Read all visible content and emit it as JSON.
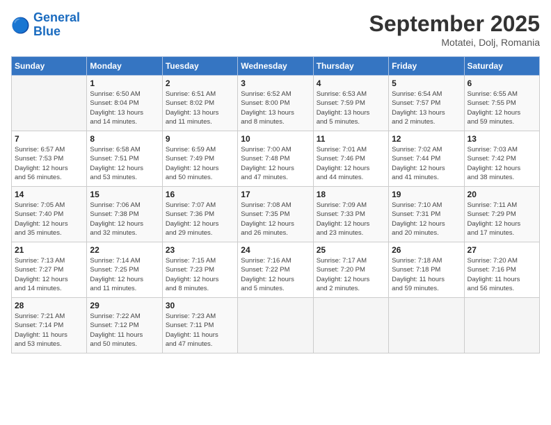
{
  "header": {
    "logo_line1": "General",
    "logo_line2": "Blue",
    "month": "September 2025",
    "location": "Motatei, Dolj, Romania"
  },
  "weekdays": [
    "Sunday",
    "Monday",
    "Tuesday",
    "Wednesday",
    "Thursday",
    "Friday",
    "Saturday"
  ],
  "weeks": [
    [
      {
        "day": "",
        "info": ""
      },
      {
        "day": "1",
        "info": "Sunrise: 6:50 AM\nSunset: 8:04 PM\nDaylight: 13 hours\nand 14 minutes."
      },
      {
        "day": "2",
        "info": "Sunrise: 6:51 AM\nSunset: 8:02 PM\nDaylight: 13 hours\nand 11 minutes."
      },
      {
        "day": "3",
        "info": "Sunrise: 6:52 AM\nSunset: 8:00 PM\nDaylight: 13 hours\nand 8 minutes."
      },
      {
        "day": "4",
        "info": "Sunrise: 6:53 AM\nSunset: 7:59 PM\nDaylight: 13 hours\nand 5 minutes."
      },
      {
        "day": "5",
        "info": "Sunrise: 6:54 AM\nSunset: 7:57 PM\nDaylight: 13 hours\nand 2 minutes."
      },
      {
        "day": "6",
        "info": "Sunrise: 6:55 AM\nSunset: 7:55 PM\nDaylight: 12 hours\nand 59 minutes."
      }
    ],
    [
      {
        "day": "7",
        "info": "Sunrise: 6:57 AM\nSunset: 7:53 PM\nDaylight: 12 hours\nand 56 minutes."
      },
      {
        "day": "8",
        "info": "Sunrise: 6:58 AM\nSunset: 7:51 PM\nDaylight: 12 hours\nand 53 minutes."
      },
      {
        "day": "9",
        "info": "Sunrise: 6:59 AM\nSunset: 7:49 PM\nDaylight: 12 hours\nand 50 minutes."
      },
      {
        "day": "10",
        "info": "Sunrise: 7:00 AM\nSunset: 7:48 PM\nDaylight: 12 hours\nand 47 minutes."
      },
      {
        "day": "11",
        "info": "Sunrise: 7:01 AM\nSunset: 7:46 PM\nDaylight: 12 hours\nand 44 minutes."
      },
      {
        "day": "12",
        "info": "Sunrise: 7:02 AM\nSunset: 7:44 PM\nDaylight: 12 hours\nand 41 minutes."
      },
      {
        "day": "13",
        "info": "Sunrise: 7:03 AM\nSunset: 7:42 PM\nDaylight: 12 hours\nand 38 minutes."
      }
    ],
    [
      {
        "day": "14",
        "info": "Sunrise: 7:05 AM\nSunset: 7:40 PM\nDaylight: 12 hours\nand 35 minutes."
      },
      {
        "day": "15",
        "info": "Sunrise: 7:06 AM\nSunset: 7:38 PM\nDaylight: 12 hours\nand 32 minutes."
      },
      {
        "day": "16",
        "info": "Sunrise: 7:07 AM\nSunset: 7:36 PM\nDaylight: 12 hours\nand 29 minutes."
      },
      {
        "day": "17",
        "info": "Sunrise: 7:08 AM\nSunset: 7:35 PM\nDaylight: 12 hours\nand 26 minutes."
      },
      {
        "day": "18",
        "info": "Sunrise: 7:09 AM\nSunset: 7:33 PM\nDaylight: 12 hours\nand 23 minutes."
      },
      {
        "day": "19",
        "info": "Sunrise: 7:10 AM\nSunset: 7:31 PM\nDaylight: 12 hours\nand 20 minutes."
      },
      {
        "day": "20",
        "info": "Sunrise: 7:11 AM\nSunset: 7:29 PM\nDaylight: 12 hours\nand 17 minutes."
      }
    ],
    [
      {
        "day": "21",
        "info": "Sunrise: 7:13 AM\nSunset: 7:27 PM\nDaylight: 12 hours\nand 14 minutes."
      },
      {
        "day": "22",
        "info": "Sunrise: 7:14 AM\nSunset: 7:25 PM\nDaylight: 12 hours\nand 11 minutes."
      },
      {
        "day": "23",
        "info": "Sunrise: 7:15 AM\nSunset: 7:23 PM\nDaylight: 12 hours\nand 8 minutes."
      },
      {
        "day": "24",
        "info": "Sunrise: 7:16 AM\nSunset: 7:22 PM\nDaylight: 12 hours\nand 5 minutes."
      },
      {
        "day": "25",
        "info": "Sunrise: 7:17 AM\nSunset: 7:20 PM\nDaylight: 12 hours\nand 2 minutes."
      },
      {
        "day": "26",
        "info": "Sunrise: 7:18 AM\nSunset: 7:18 PM\nDaylight: 11 hours\nand 59 minutes."
      },
      {
        "day": "27",
        "info": "Sunrise: 7:20 AM\nSunset: 7:16 PM\nDaylight: 11 hours\nand 56 minutes."
      }
    ],
    [
      {
        "day": "28",
        "info": "Sunrise: 7:21 AM\nSunset: 7:14 PM\nDaylight: 11 hours\nand 53 minutes."
      },
      {
        "day": "29",
        "info": "Sunrise: 7:22 AM\nSunset: 7:12 PM\nDaylight: 11 hours\nand 50 minutes."
      },
      {
        "day": "30",
        "info": "Sunrise: 7:23 AM\nSunset: 7:11 PM\nDaylight: 11 hours\nand 47 minutes."
      },
      {
        "day": "",
        "info": ""
      },
      {
        "day": "",
        "info": ""
      },
      {
        "day": "",
        "info": ""
      },
      {
        "day": "",
        "info": ""
      }
    ]
  ]
}
